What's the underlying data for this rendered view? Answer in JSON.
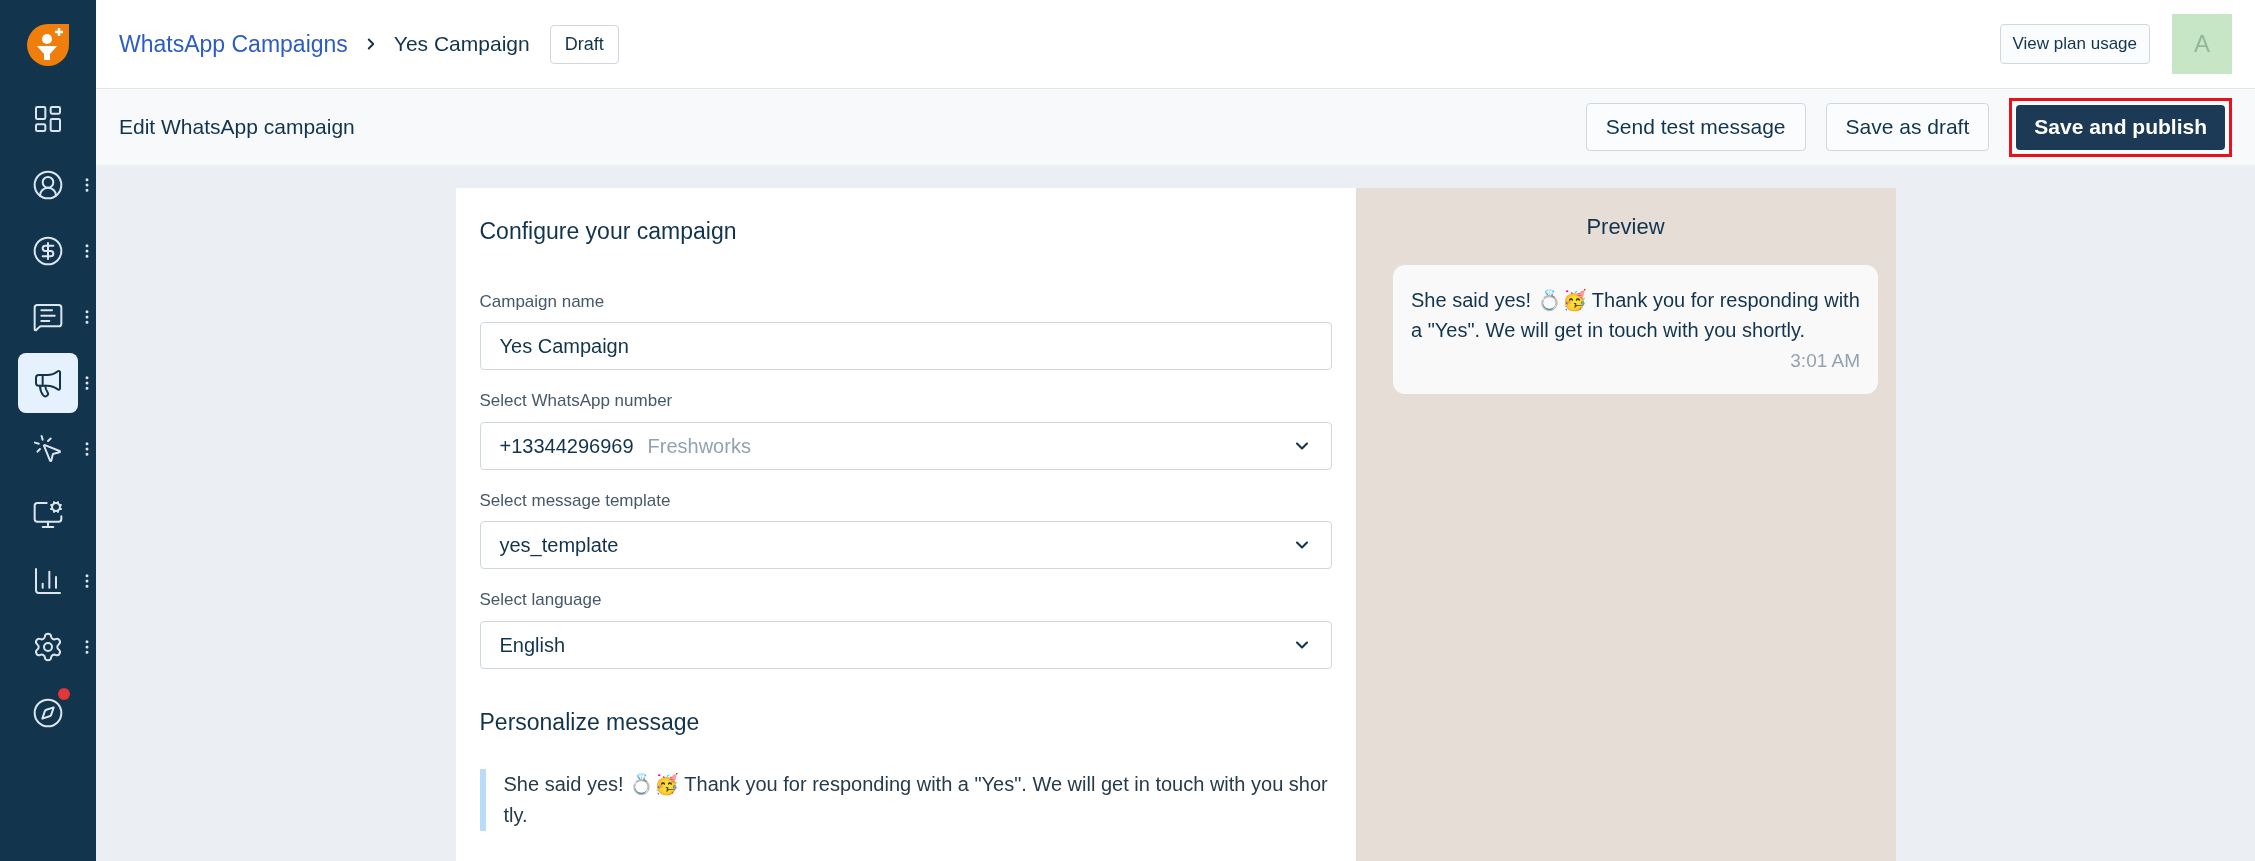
{
  "sidebar": {
    "items": [
      {
        "kind": "dashboard",
        "selected": false,
        "has_menu": false,
        "badge": false
      },
      {
        "kind": "contacts",
        "selected": false,
        "has_menu": true,
        "badge": false
      },
      {
        "kind": "deals",
        "selected": false,
        "has_menu": true,
        "badge": false
      },
      {
        "kind": "conversations",
        "selected": false,
        "has_menu": true,
        "badge": false
      },
      {
        "kind": "campaigns",
        "selected": true,
        "has_menu": true,
        "badge": false
      },
      {
        "kind": "automation",
        "selected": false,
        "has_menu": true,
        "badge": false
      },
      {
        "kind": "web",
        "selected": false,
        "has_menu": false,
        "badge": false
      },
      {
        "kind": "reports",
        "selected": false,
        "has_menu": true,
        "badge": false
      },
      {
        "kind": "settings",
        "selected": false,
        "has_menu": true,
        "badge": false
      },
      {
        "kind": "explore",
        "selected": false,
        "has_menu": false,
        "badge": true
      }
    ]
  },
  "header": {
    "breadcrumb": {
      "parent": "WhatsApp Campaigns",
      "current": "Yes Campaign"
    },
    "status": "Draft",
    "plan_button": "View plan usage",
    "avatar": "A"
  },
  "toolbar": {
    "title": "Edit WhatsApp campaign",
    "buttons": [
      {
        "label": "Send test message",
        "primary": false
      },
      {
        "label": "Save as draft",
        "primary": false
      },
      {
        "label": "Save and publish",
        "primary": true
      }
    ]
  },
  "form": {
    "title": "Configure your campaign",
    "fields": [
      {
        "kind": "text",
        "label": "Campaign name",
        "value": "Yes Campaign"
      },
      {
        "kind": "select",
        "label": "Select WhatsApp number",
        "value": "+13344296969",
        "hint": "Freshworks"
      },
      {
        "kind": "select",
        "label": "Select message template",
        "value": "yes_template"
      },
      {
        "kind": "select",
        "label": "Select language",
        "value": "English"
      }
    ],
    "personalize": {
      "title": "Personalize message",
      "message": "She said yes! 💍🥳 Thank you for responding with a \"Yes\". We will get in touch with you shortly."
    }
  },
  "preview": {
    "title": "Preview",
    "message": "She said yes! 💍🥳 Thank you for responding with a \"Yes\". We will get in touch with you shortly.",
    "time": "3:01 AM"
  }
}
